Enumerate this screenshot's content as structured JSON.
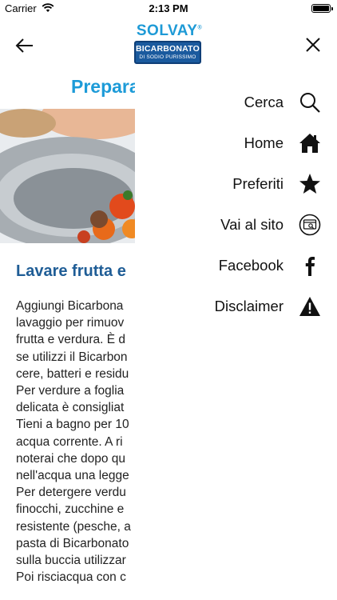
{
  "status_bar": {
    "carrier": "Carrier",
    "time": "2:13 PM"
  },
  "logo": {
    "brand": "SOLVAY",
    "line1": "BICARBONATO",
    "line2": "DI SODIO PURISSIMO"
  },
  "article": {
    "title": "Prepara",
    "subtitle": "Lavare frutta e",
    "lines": [
      "Aggiungi Bicarbona",
      "lavaggio per rimuov",
      "frutta e verdura. È d",
      "se utilizzi il Bicarbon",
      "cere, batteri e residu",
      "Per verdure a foglia",
      "delicata è consigliat",
      "Tieni a bagno per 10",
      "acqua corrente. A ri",
      "noterai che dopo qu",
      "nell'acqua una legge",
      "Per detergere verdu",
      "finocchi, zucchine e",
      "resistente (pesche, a",
      "pasta di Bicarbonato",
      "sulla buccia utilizzar",
      "Poi risciacqua con c"
    ]
  },
  "menu": {
    "items": [
      {
        "label": "Cerca",
        "icon": "search-icon"
      },
      {
        "label": "Home",
        "icon": "home-icon"
      },
      {
        "label": "Preferiti",
        "icon": "star-icon"
      },
      {
        "label": "Vai al sito",
        "icon": "website-icon"
      },
      {
        "label": "Facebook",
        "icon": "facebook-icon"
      },
      {
        "label": "Disclaimer",
        "icon": "warning-icon"
      }
    ]
  },
  "colors": {
    "brand_blue": "#1d9bd8",
    "dark_blue": "#1f5d96",
    "logo_box": "#1a5a9e"
  }
}
